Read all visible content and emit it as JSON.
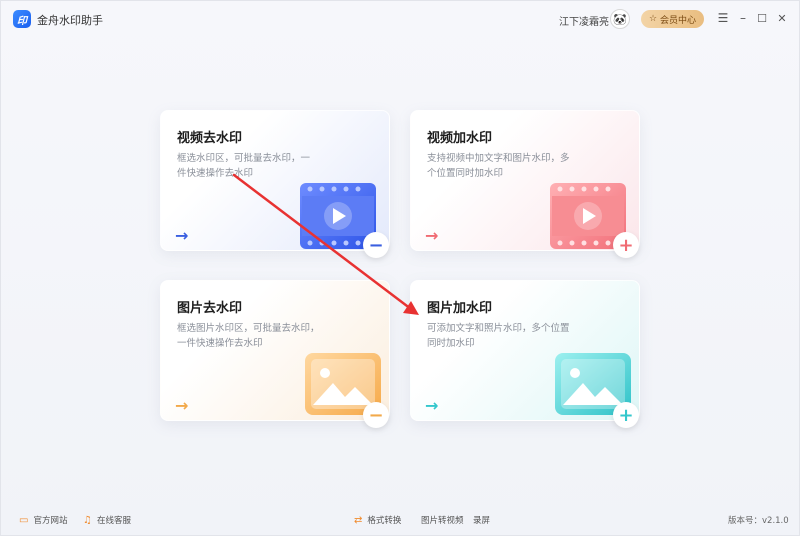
{
  "app": {
    "title": "金舟水印助手",
    "logo_text": "印"
  },
  "user": {
    "name": "江下凌霜亮",
    "avatar_glyph": "🐼",
    "member_label": "会员中心",
    "member_icon": "☆"
  },
  "window": {
    "menu": "☰",
    "minimize": "–",
    "maximize": "☐",
    "close": "✕"
  },
  "cards": [
    {
      "title": "视频去水印",
      "desc": "框选水印区，可批量去水印，一件快速操作去水印",
      "arrow": "→",
      "accent": "#3a5fe0",
      "action": "−"
    },
    {
      "title": "视频加水印",
      "desc": "支持视频中加文字和图片水印，多个位置同时加水印",
      "arrow": "→",
      "accent": "#f06b73",
      "action": "+"
    },
    {
      "title": "图片去水印",
      "desc": "框选图片水印区，可批量去水印，一件快速操作去水印",
      "arrow": "→",
      "accent": "#f2a94a",
      "action": "−"
    },
    {
      "title": "图片加水印",
      "desc": "可添加文字和照片水印，多个位置同时加水印",
      "arrow": "→",
      "accent": "#34c7cc",
      "action": "+"
    }
  ],
  "footer": {
    "official_site": "官方网站",
    "online_service": "在线客服",
    "format_convert": "格式转换",
    "image_to_video": "图片转视频",
    "screen_record": "录屏",
    "version": "版本号：v2.1.0"
  }
}
